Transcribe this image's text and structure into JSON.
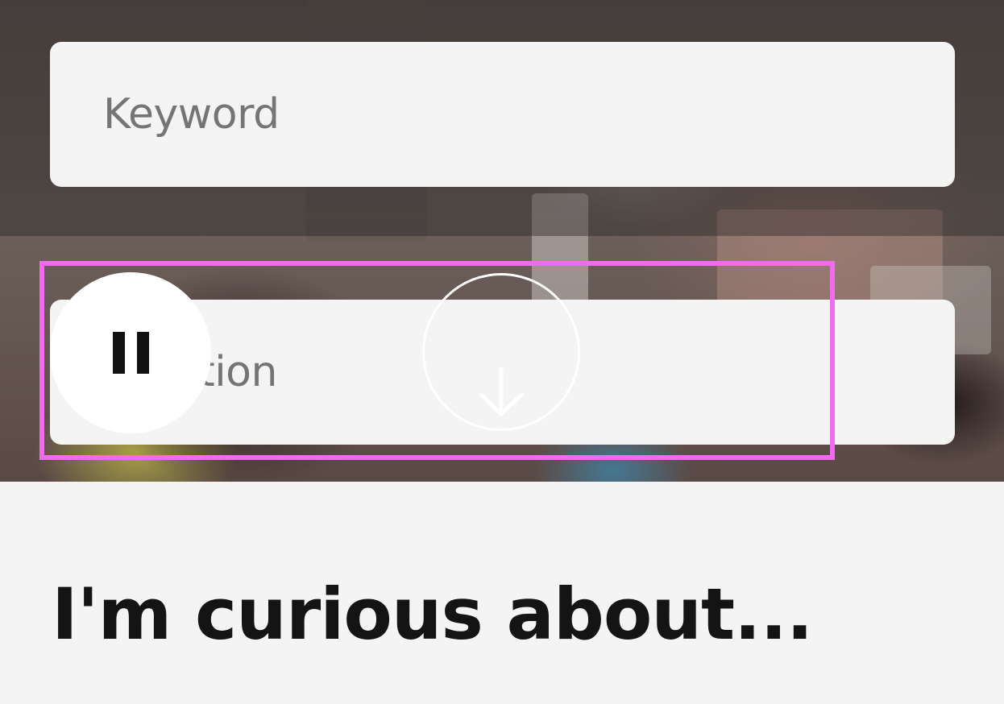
{
  "search": {
    "keyword_placeholder": "Keyword",
    "location_placeholder": "Location"
  },
  "video_controls": {
    "pause_icon": "pause-icon",
    "scroll_icon": "arrow-down-icon"
  },
  "section": {
    "heading": "I'm curious about..."
  },
  "colors": {
    "highlight": "#f36af0",
    "field_background": "#f4f4f4",
    "heading_text": "#141414"
  }
}
